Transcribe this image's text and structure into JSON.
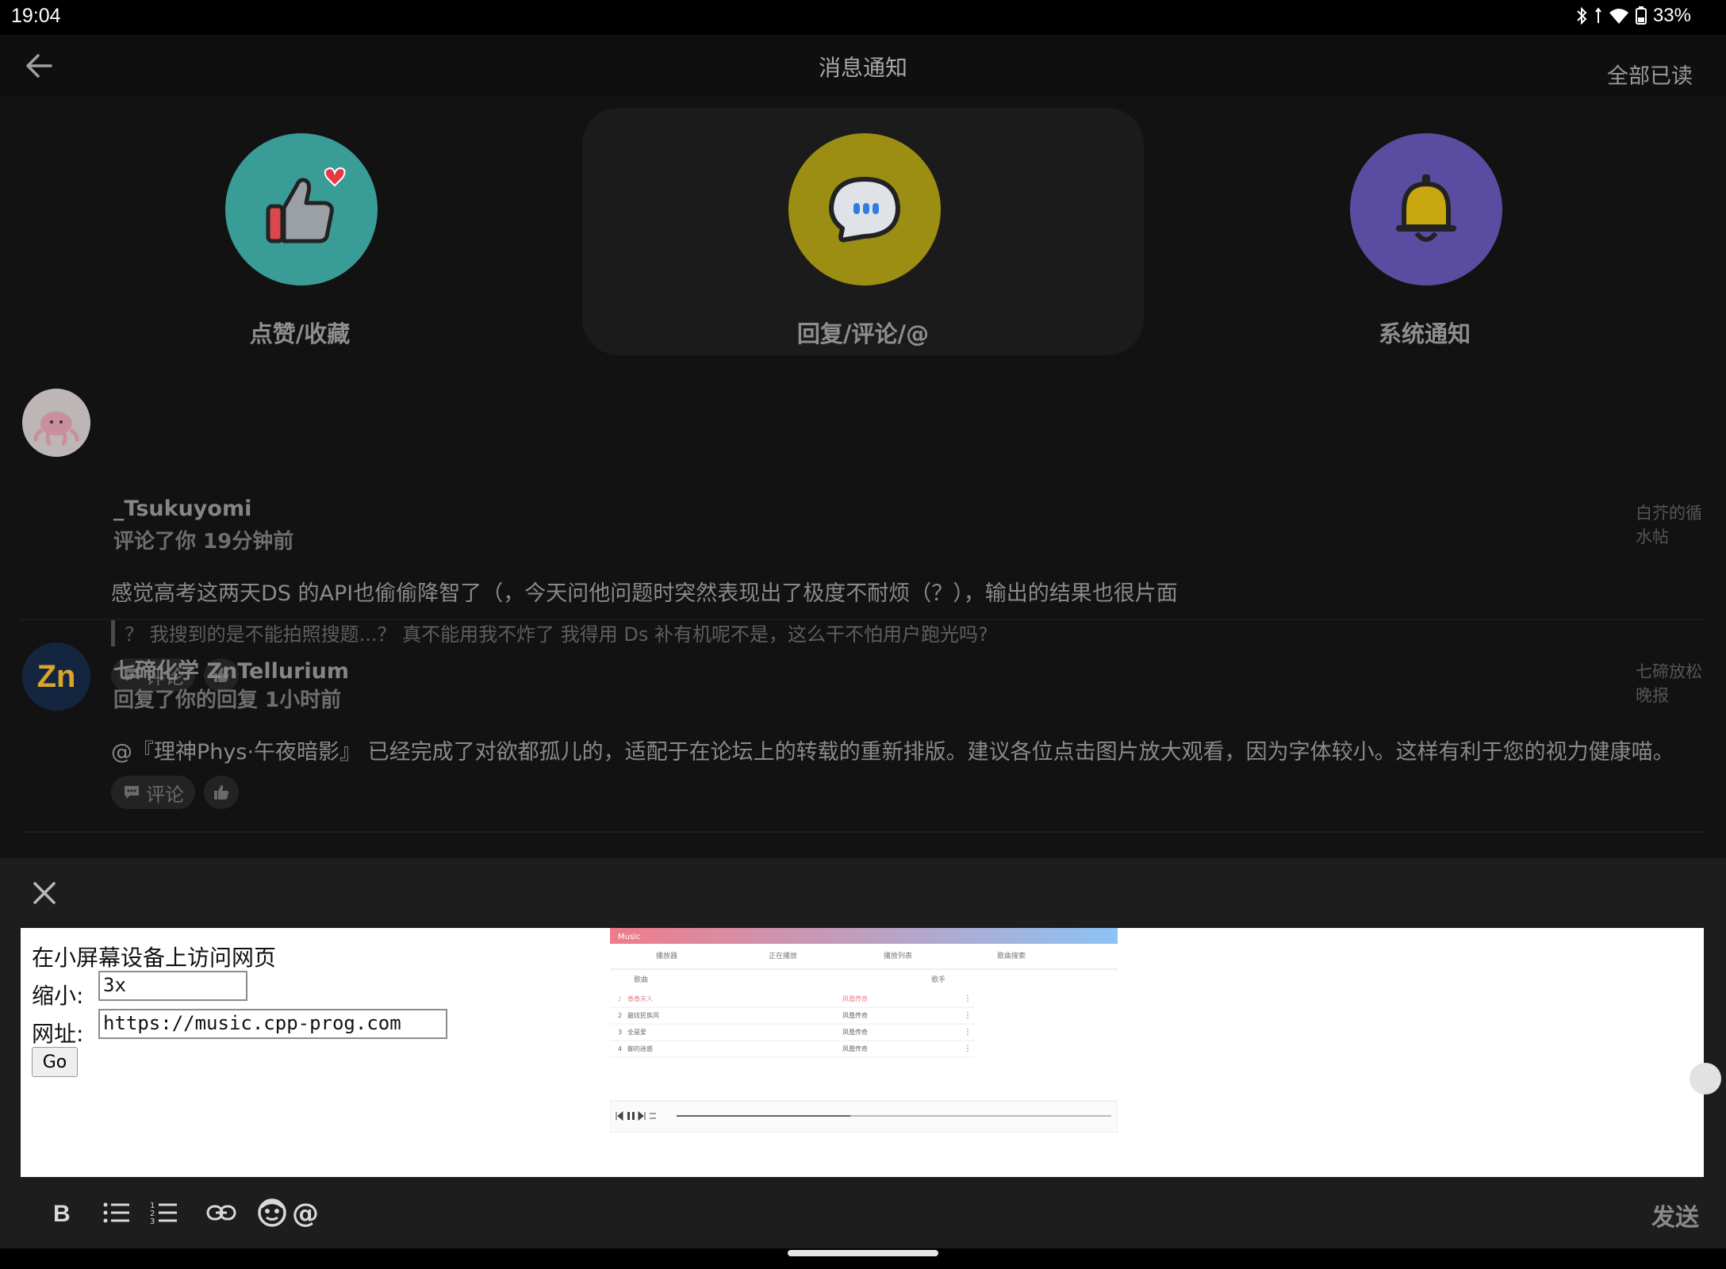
{
  "status": {
    "time": "19:04",
    "battery": "33%"
  },
  "header": {
    "title": "消息通知",
    "mark_all_read": "全部已读"
  },
  "categories": [
    {
      "label": "点赞/收藏",
      "icon": "thumbs-up-heart-icon",
      "color": "#3a9c96"
    },
    {
      "label": "回复/评论/@",
      "icon": "chat-bubble-icon",
      "color": "#9c8e12",
      "active": true
    },
    {
      "label": "系统通知",
      "icon": "bell-icon",
      "color": "#5a4ca0"
    }
  ],
  "notifications": [
    {
      "user": "_Tsukuyomi",
      "meta": "评论了你 19分钟前",
      "post": "白芥的循水帖",
      "text": "感觉高考这两天DS 的API也偷偷降智了（，今天问他问题时突然表现出了极度不耐烦（？），输出的结果也很片面",
      "quote": "？ 我搜到的是不能拍照搜题...？ 真不能用我不炸了 我得用 Ds 补有机呢不是，这么干不怕用户跑光吗?",
      "comment_label": "评论"
    },
    {
      "user": "七碲化学 ZnTellurium",
      "meta": "回复了你的回复 1小时前",
      "post": "七碲放松晚报",
      "avatar_text": "Zn",
      "text": "@『理神Phys·午夜暗影』 已经完成了对欲都孤儿的，适配于在论坛上的转载的重新排版。建议各位点击图片放大观看，因为字体较小。这样有利于您的视力健康喵。",
      "comment_label": "评论"
    }
  ],
  "editor": {
    "heading": "在小屏幕设备上访问网页",
    "shrink_label": "缩小:",
    "shrink_value": "3x",
    "url_label": "网址:",
    "url_value": "https://music.cpp-prog.com",
    "go_label": "Go",
    "preview": {
      "app_title": "Music",
      "tabs": [
        "播放器",
        "正在播放",
        "播放列表",
        "歌曲搜索"
      ],
      "columns": [
        "歌曲",
        "歌手"
      ],
      "rows": [
        {
          "num": "♪",
          "song": "香香夫人",
          "artist": "凤凰传奇"
        },
        {
          "num": "2",
          "song": "最炫民族风",
          "artist": "凤凰传奇"
        },
        {
          "num": "3",
          "song": "全是爱",
          "artist": "凤凰传奇"
        },
        {
          "num": "4",
          "song": "御的迷惑",
          "artist": "凤凰传奇"
        }
      ],
      "progress": 0.4
    }
  },
  "toolbar": {
    "send": "发送"
  }
}
